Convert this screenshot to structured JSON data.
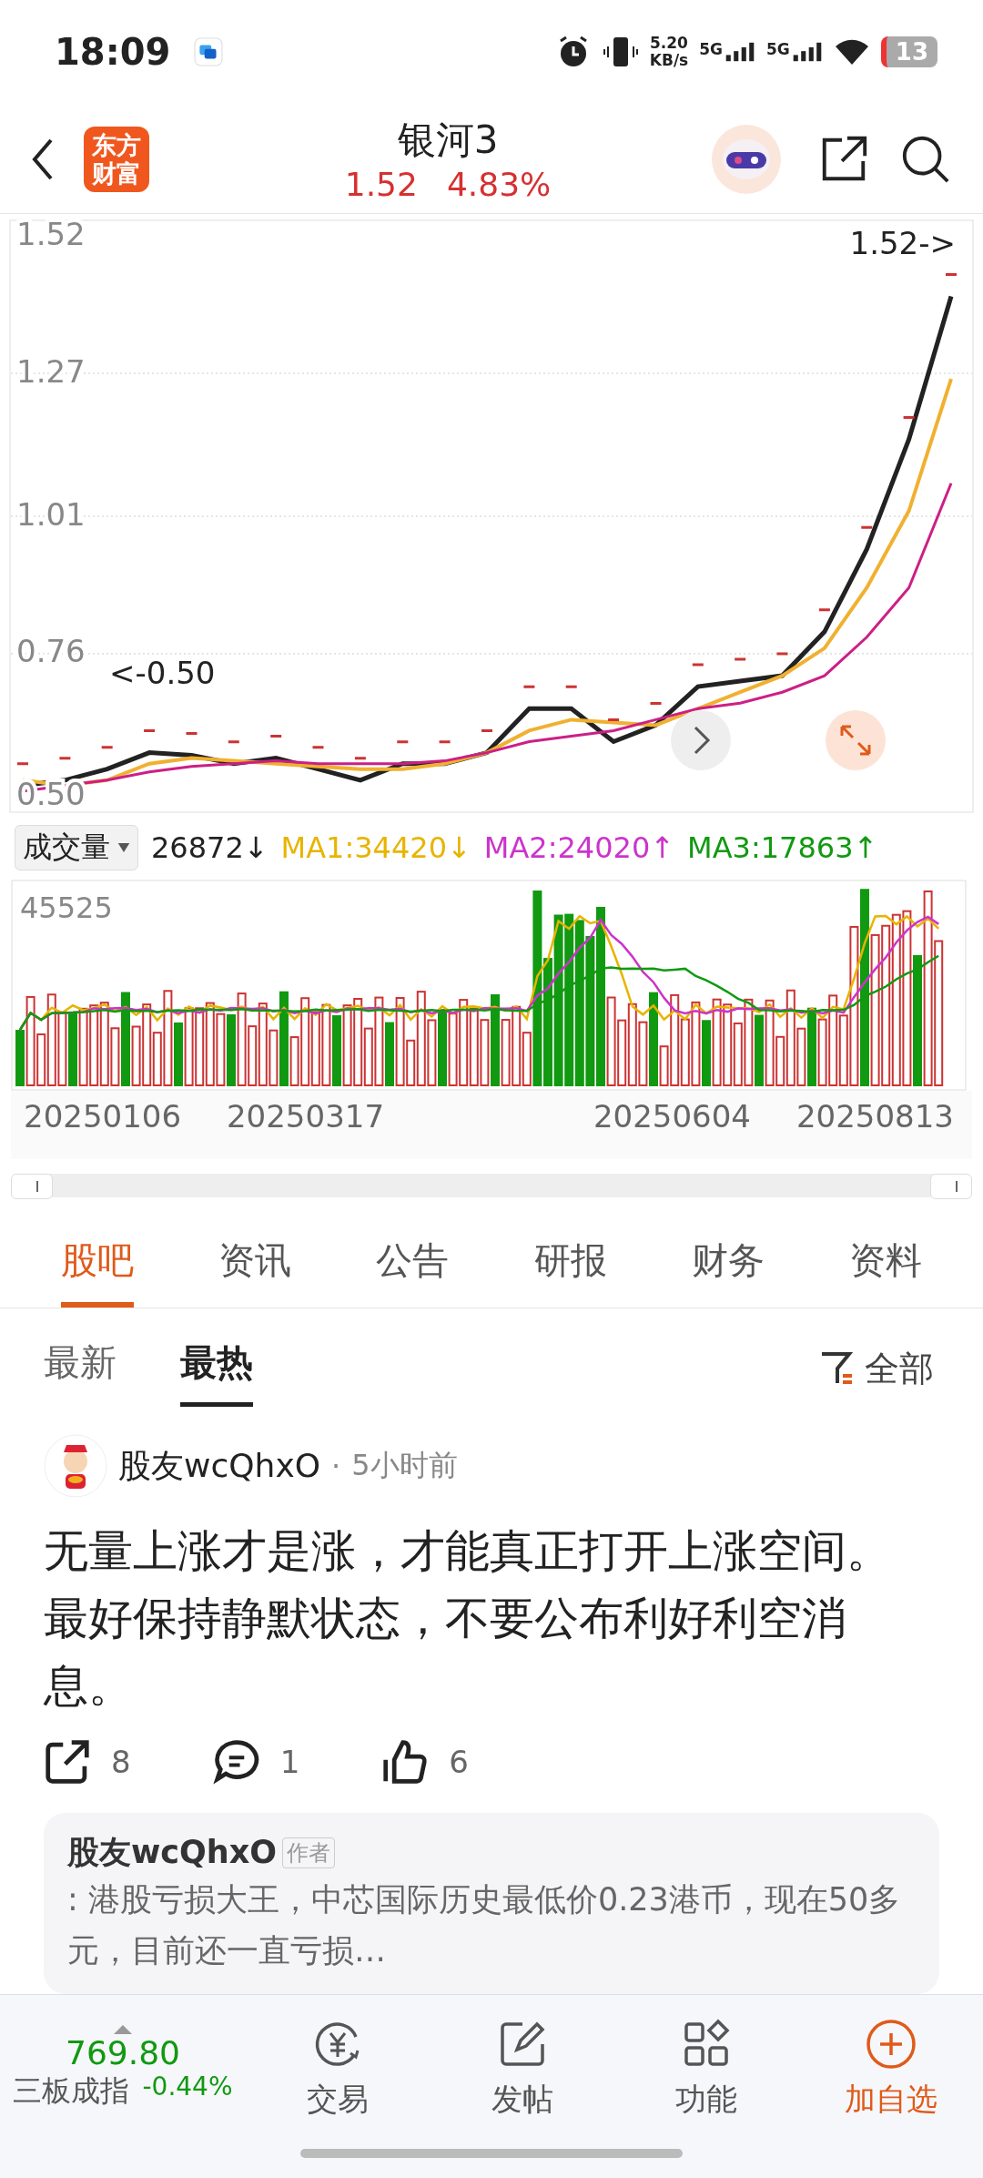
{
  "status_bar": {
    "time": "18:09",
    "net_speed_value": "5.20",
    "net_speed_unit": "KB/s",
    "signal_1": "5G",
    "signal_2": "5G",
    "battery": "13"
  },
  "header": {
    "logo_top": "东方",
    "logo_bottom": "财富",
    "title": "银河3",
    "price": "1.52",
    "change": "4.83%"
  },
  "price_chart": {
    "high_marker": "1.52->",
    "low_marker": "<-0.50",
    "chart_data": {
      "type": "line",
      "ylim": [
        0.47,
        1.55
      ],
      "grid": true,
      "yticks": [
        {
          "value": 0.5,
          "label": "0.50"
        },
        0.76,
        1.01,
        1.27,
        1.52
      ],
      "series": [
        {
          "color": "#222222",
          "values": [
            0.52,
            0.53,
            0.55,
            0.58,
            0.575,
            0.56,
            0.57,
            0.55,
            0.53,
            0.56,
            0.56,
            0.58,
            0.66,
            0.66,
            0.6,
            0.63,
            0.7,
            0.71,
            0.72,
            0.8,
            0.95,
            1.15,
            1.41
          ]
        },
        {
          "color": "#f0b030",
          "values": [
            0.53,
            0.52,
            0.53,
            0.56,
            0.57,
            0.565,
            0.56,
            0.555,
            0.55,
            0.55,
            0.56,
            0.58,
            0.62,
            0.64,
            0.635,
            0.63,
            0.66,
            0.69,
            0.72,
            0.77,
            0.88,
            1.02,
            1.26
          ]
        },
        {
          "color": "#cc1f86",
          "values": [
            0.51,
            0.52,
            0.53,
            0.545,
            0.555,
            0.56,
            0.565,
            0.56,
            0.56,
            0.56,
            0.565,
            0.58,
            0.6,
            0.61,
            0.62,
            0.64,
            0.66,
            0.67,
            0.69,
            0.72,
            0.79,
            0.88,
            1.07
          ]
        }
      ]
    }
  },
  "volume": {
    "selector": "成交量",
    "legend": [
      {
        "text": "26872↓",
        "color": "#222222"
      },
      {
        "text": "MA1:34420↓",
        "color": "#e8b400"
      },
      {
        "text": "MA2:24020↑",
        "color": "#cc33cc"
      },
      {
        "text": "MA3:17863↑",
        "color": "#119911"
      }
    ],
    "max_label": "45525",
    "dates": [
      "20250106",
      "20250317",
      "20250604",
      "20250813"
    ]
  },
  "range_slider": {
    "level": 1
  },
  "tabs": [
    {
      "label": "股吧",
      "selected": true
    },
    {
      "label": "资讯",
      "selected": false
    },
    {
      "label": "公告",
      "selected": false
    },
    {
      "label": "研报",
      "selected": false
    },
    {
      "label": "财务",
      "selected": false
    },
    {
      "label": "资料",
      "selected": false
    }
  ],
  "sort_tabs": [
    {
      "label": "最新",
      "selected": false
    },
    {
      "label": "最热",
      "selected": true
    }
  ],
  "filter": "全部",
  "post": {
    "author": "股友wcQhxO",
    "separator": "·",
    "time": "5小时前",
    "text": "无量上涨才是涨，才能真正打开上涨空间。最好保持静默状态，不要公布利好利空消息。",
    "actions": [
      {
        "kind": "share",
        "count": "8"
      },
      {
        "kind": "comment",
        "count": "1"
      },
      {
        "kind": "like",
        "count": "6"
      }
    ],
    "reply": {
      "author": "股友wcQhxO",
      "badge": "作者",
      "text": ": 港股亏损大王，中芯国际历史最低价0.23港币，现在50多元，目前还一直亏损…"
    }
  },
  "bottom_bar": {
    "index_value": "769.80",
    "index_name": "三板成指",
    "index_change": "-0.44%",
    "items": [
      {
        "kind": "trade",
        "label": "交易"
      },
      {
        "kind": "post",
        "label": "发帖"
      },
      {
        "kind": "tools",
        "label": "功能"
      },
      {
        "kind": "add",
        "label": "加自选"
      }
    ]
  }
}
